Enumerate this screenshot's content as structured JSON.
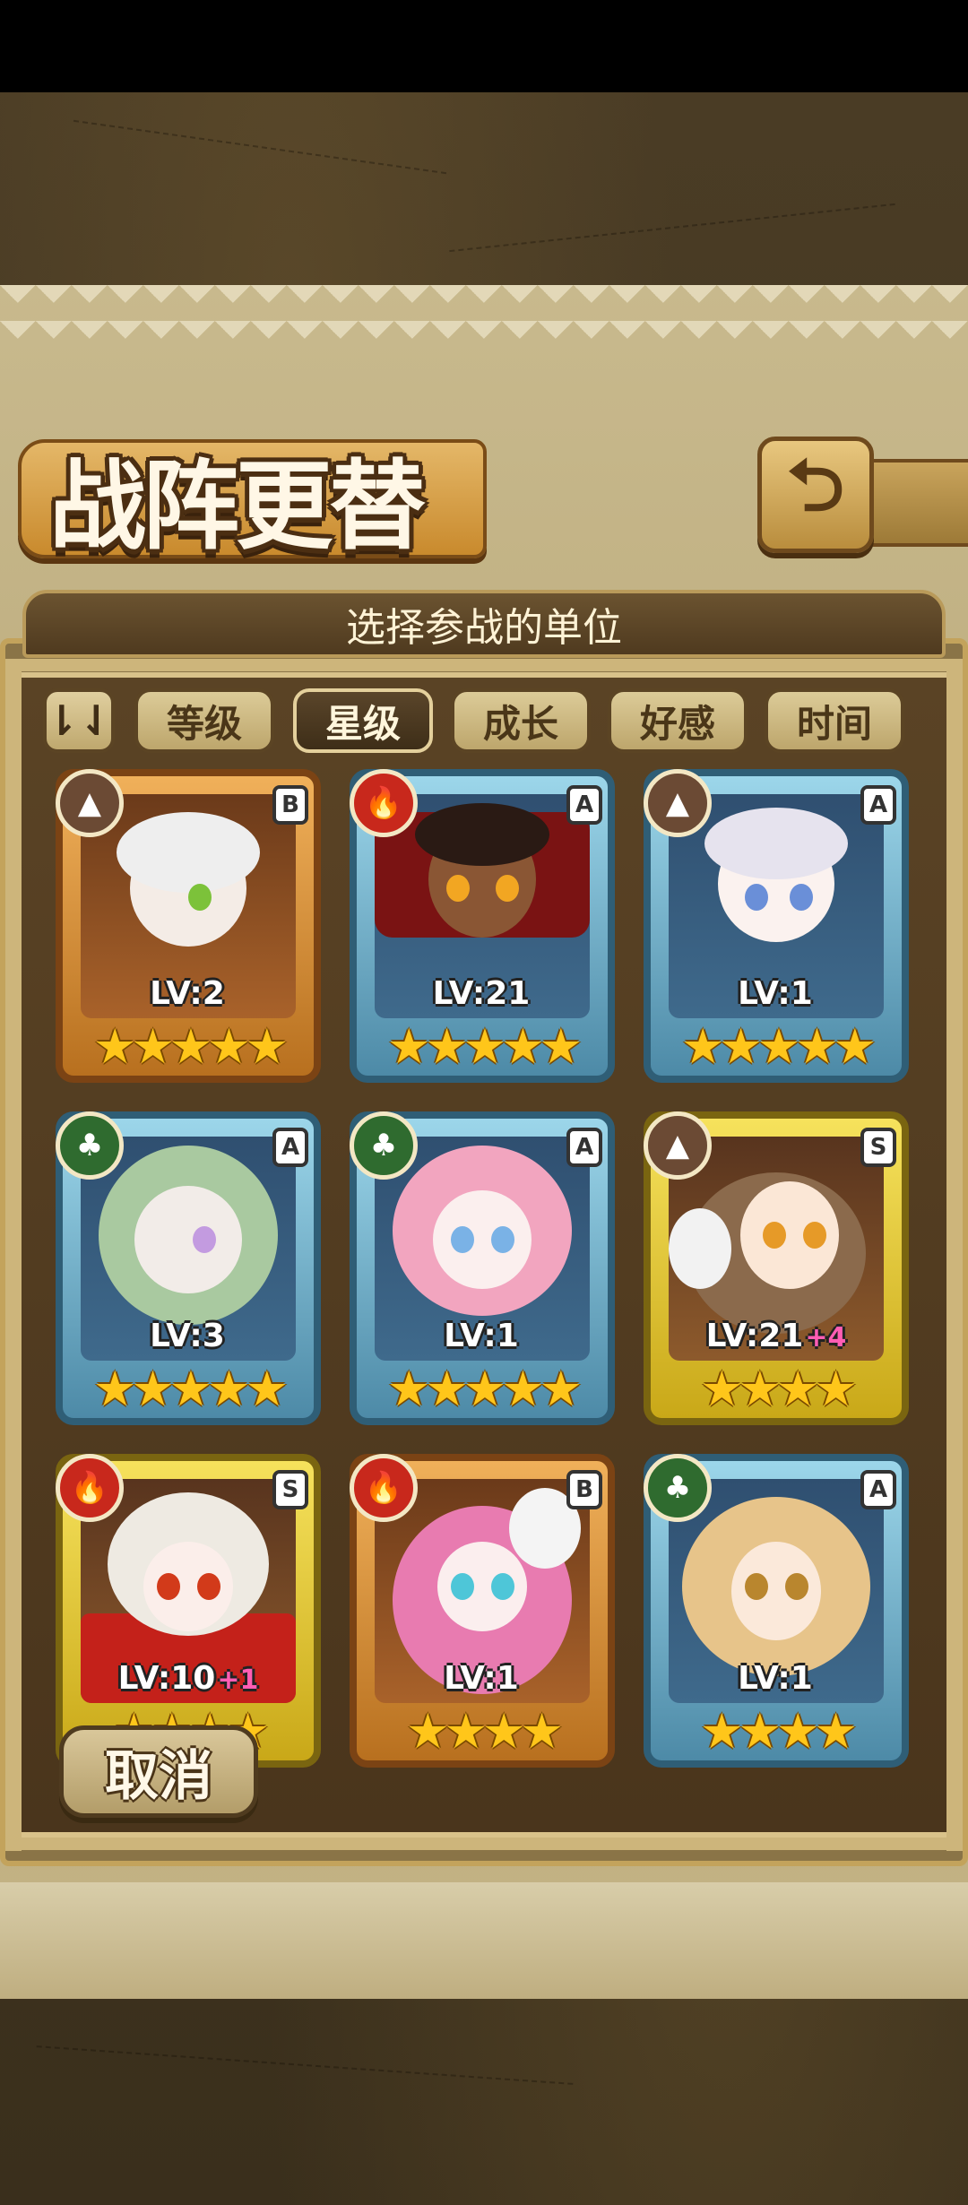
{
  "title": "战阵更替",
  "subtitle": "选择参战的单位",
  "back_icon": "return-arrow-icon",
  "sort_toggle": {
    "icon": "sort-order-icon",
    "glyph": "⇂⇃"
  },
  "tabs": [
    {
      "label": "等级",
      "active": false
    },
    {
      "label": "星级",
      "active": true
    },
    {
      "label": "成长",
      "active": false
    },
    {
      "label": "好感",
      "active": false
    },
    {
      "label": "时间",
      "active": false
    }
  ],
  "units": [
    {
      "element": "earth",
      "rank": "B",
      "level": "LV:2",
      "bonus": "",
      "stars": "★★★★★",
      "frame": "orange"
    },
    {
      "element": "fire",
      "rank": "A",
      "level": "LV:21",
      "bonus": "",
      "stars": "★★★★★",
      "frame": "blue"
    },
    {
      "element": "earth",
      "rank": "A",
      "level": "LV:1",
      "bonus": "",
      "stars": "★★★★★",
      "frame": "blue"
    },
    {
      "element": "leaf",
      "rank": "A",
      "level": "LV:3",
      "bonus": "",
      "stars": "★★★★★",
      "frame": "blue"
    },
    {
      "element": "leaf",
      "rank": "A",
      "level": "LV:1",
      "bonus": "",
      "stars": "★★★★★",
      "frame": "blue"
    },
    {
      "element": "earth",
      "rank": "S",
      "level": "LV:21",
      "bonus": "+4",
      "stars": "★★★★",
      "frame": "yellow"
    },
    {
      "element": "fire",
      "rank": "S",
      "level": "LV:10",
      "bonus": "+1",
      "stars": "★★★★",
      "frame": "yellow"
    },
    {
      "element": "fire",
      "rank": "B",
      "level": "LV:1",
      "bonus": "",
      "stars": "★★★★",
      "frame": "orange"
    },
    {
      "element": "leaf",
      "rank": "A",
      "level": "LV:1",
      "bonus": "",
      "stars": "★★★★",
      "frame": "blue"
    }
  ],
  "cancel_label": "取消",
  "colors": {
    "frame_blue": "#4d8aa7",
    "frame_orange": "#b8701f",
    "frame_yellow": "#c9a818",
    "fire": "#c8281c",
    "leaf": "#2f6b2f",
    "earth": "#6b4a34",
    "star": "#ffc61a",
    "bonus": "#ff5db4"
  }
}
